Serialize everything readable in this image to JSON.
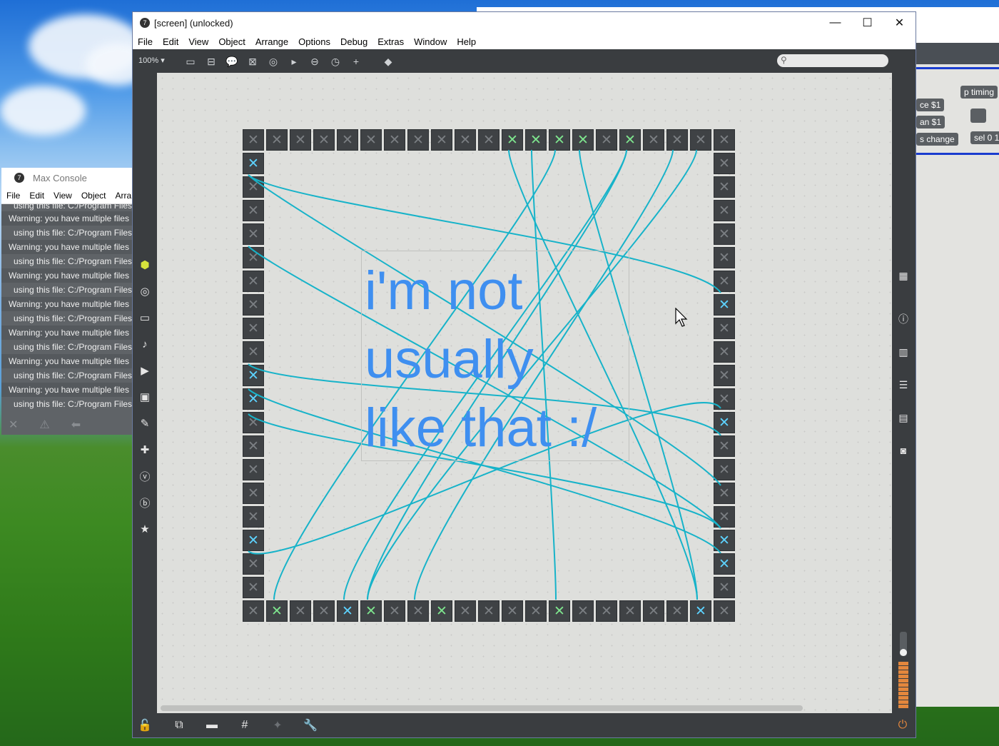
{
  "window": {
    "title": "[screen] (unlocked)",
    "menus": [
      "File",
      "Edit",
      "View",
      "Object",
      "Arrange",
      "Options",
      "Debug",
      "Extras",
      "Window",
      "Help"
    ],
    "zoom": "100%",
    "controls": {
      "minimize": "—",
      "maximize": "☐",
      "close": "✕"
    }
  },
  "console": {
    "title": "Max Console",
    "menus": [
      "File",
      "Edit",
      "View",
      "Object",
      "Arra"
    ],
    "lines": [
      {
        "text": "using this file: C:/Program Files",
        "kind": "using"
      },
      {
        "text": "Warning: you have multiple files",
        "kind": "warn"
      },
      {
        "text": "using this file: C:/Program Files",
        "kind": "using"
      },
      {
        "text": "Warning: you have multiple files",
        "kind": "warn"
      },
      {
        "text": "using this file: C:/Program Files",
        "kind": "using"
      },
      {
        "text": "Warning: you have multiple files",
        "kind": "warn"
      },
      {
        "text": "using this file: C:/Program Files",
        "kind": "using"
      },
      {
        "text": "Warning: you have multiple files",
        "kind": "warn"
      },
      {
        "text": "using this file: C:/Program Files",
        "kind": "using"
      },
      {
        "text": "Warning: you have multiple files",
        "kind": "warn"
      },
      {
        "text": "using this file: C:/Program Files",
        "kind": "using"
      },
      {
        "text": "Warning: you have multiple files",
        "kind": "warn"
      },
      {
        "text": "using this file: C:/Program Files",
        "kind": "using"
      },
      {
        "text": "Warning: you have multiple files",
        "kind": "warn"
      },
      {
        "text": "using this file: C:/Program Files",
        "kind": "using"
      }
    ]
  },
  "comment": {
    "text": "i'm not\nusually\nlike that :/"
  },
  "background_patch": {
    "objects": [
      "p timing",
      "ce $1",
      "an $1",
      "s change",
      "sel 0 1"
    ]
  },
  "grid": {
    "top": [
      "off",
      "off",
      "off",
      "off",
      "off",
      "off",
      "off",
      "off",
      "off",
      "off",
      "off",
      "green",
      "green",
      "green",
      "green",
      "off",
      "green",
      "off",
      "off",
      "off",
      "off"
    ],
    "bottom": [
      "off",
      "green",
      "off",
      "off",
      "blue",
      "green",
      "off",
      "off",
      "green",
      "off",
      "off",
      "off",
      "off",
      "green",
      "off",
      "off",
      "off",
      "off",
      "off",
      "blue",
      "off"
    ],
    "left": [
      "blue",
      "off",
      "off",
      "off",
      "off",
      "off",
      "off",
      "off",
      "off",
      "blue",
      "blue",
      "off",
      "off",
      "off",
      "off",
      "off",
      "blue",
      "off",
      "off"
    ],
    "right": [
      "off",
      "off",
      "off",
      "off",
      "off",
      "off",
      "blue",
      "off",
      "off",
      "off",
      "off",
      "blue",
      "off",
      "off",
      "off",
      "off",
      "blue",
      "blue",
      "off"
    ]
  },
  "colors": {
    "wire": "#17b3c9",
    "comment_text": "#3f8ff0",
    "toggle_blue": "#5dd3ff",
    "toggle_green": "#7ee58e"
  }
}
